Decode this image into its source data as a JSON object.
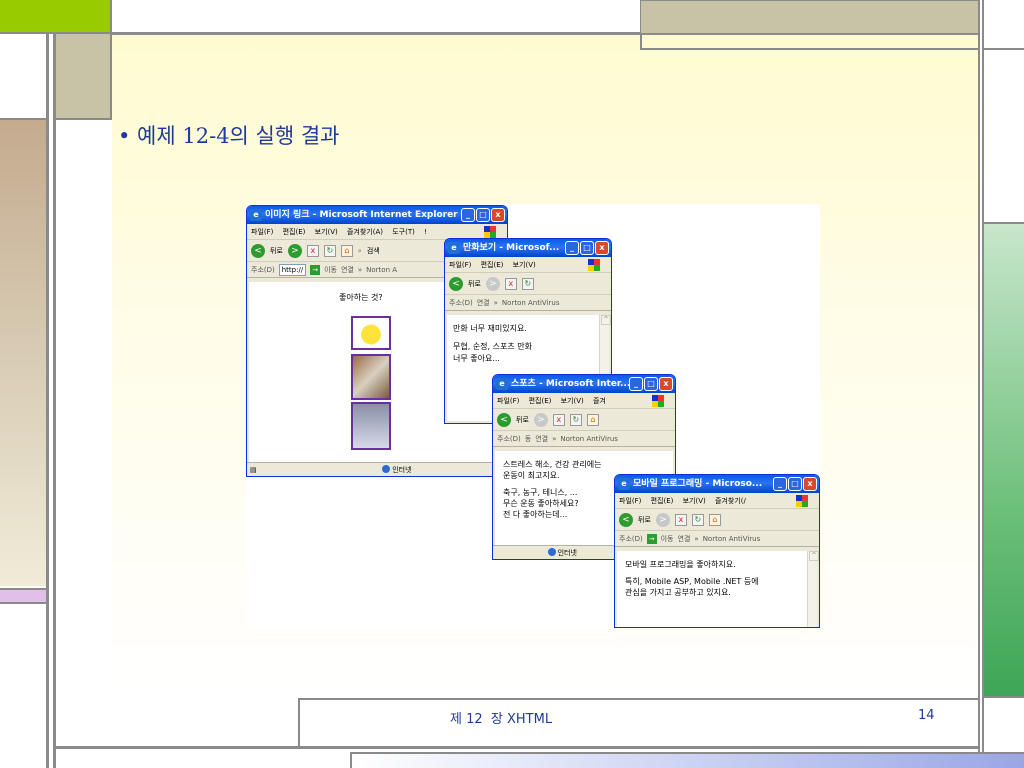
{
  "slide": {
    "bullet_text": "• 예제 12-4의 실행 결과",
    "footer_chapter": "제 12  장 XHTML",
    "page_number": "14"
  },
  "colors": {
    "accent_green": "#99cc00",
    "accent_tan": "#c8c3a6",
    "accent_pink": "#e0c0e8",
    "accent_teal": "#3ea556",
    "title_blue": "#1f3a9a"
  },
  "window1": {
    "title": "이미지 링크 - Microsoft Internet Explorer",
    "menu": [
      "파일(F)",
      "편집(E)",
      "보기(V)",
      "즐겨찾기(A)",
      "도구(T)",
      "!"
    ],
    "back_label": "뒤로",
    "search_label": "검색",
    "address_label": "주소(D)",
    "address_value": "http://",
    "go_label": "이동",
    "links_label": "연결",
    "extra_toolbar": "Norton A",
    "content_heading": "좋아하는 것?",
    "status_zone": "인터넷",
    "images": [
      "pikachu-image",
      "sports-image",
      "pda-image"
    ]
  },
  "window2": {
    "title": "만화보기 - Microsof...",
    "menu": [
      "파일(F)",
      "편집(E)",
      "보기(V)"
    ],
    "back_label": "뒤로",
    "address_label": "주소(D)",
    "links_label": "연결",
    "toolbar_extra": "Norton AntiVirus",
    "content_lines": [
      "만화 너무 재미있지요.",
      "",
      "무협, 순정, 스포츠 만화",
      "너무 좋아요..."
    ]
  },
  "window3": {
    "title": "스포츠 - Microsoft Inter...",
    "menu": [
      "파일(F)",
      "편집(E)",
      "보기(V)",
      "즐겨"
    ],
    "back_label": "뒤로",
    "address_label": "주소(D)",
    "address_extra": "동",
    "links_label": "연결",
    "toolbar_extra": "Norton AntiVirus",
    "content_lines": [
      "스트레스 해소, 건강 관리에는",
      "운동이 최고지요.",
      "",
      "축구, 농구, 테니스, ...",
      "무슨 운동 좋아하세요?",
      "전 다 좋아하는데..."
    ],
    "status_zone": "인터넷"
  },
  "window4": {
    "title": "모바일 프로그래밍 - Microso...",
    "menu": [
      "파일(F)",
      "편집(E)",
      "보기(V)",
      "즐겨찾기(/"
    ],
    "back_label": "뒤로",
    "address_label": "주소(D)",
    "go_label": "이동",
    "links_label": "연결",
    "toolbar_extra": "Norton AntiVirus",
    "content_lines": [
      "모바일 프로그래밍을 좋아하지요.",
      "",
      "특히, Mobile ASP, Mobile .NET 등에",
      "관심을 가지고 공부하고 있지요."
    ]
  }
}
